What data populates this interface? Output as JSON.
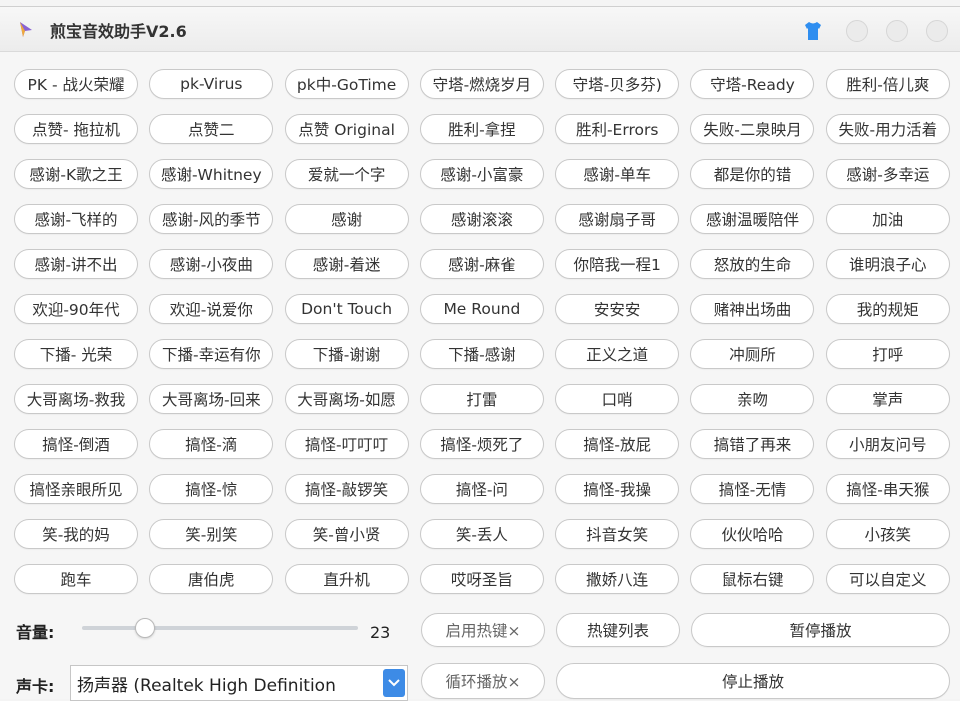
{
  "app": {
    "title": "煎宝音效助手V2.6"
  },
  "sound_buttons": [
    "PK - 战火荣耀",
    "pk-Virus",
    "pk中-GoTime",
    "守塔-燃烧岁月",
    "守塔-贝多芬)",
    "守塔-Ready",
    "胜利-倍儿爽",
    "点赞- 拖拉机",
    "点赞二",
    "点赞 Original",
    "胜利-拿捏",
    "胜利-Errors",
    "失败-二泉映月",
    "失败-用力活着",
    "感谢-K歌之王",
    "感谢-Whitney",
    "爱就一个字",
    "感谢-小富豪",
    "感谢-单车",
    "都是你的错",
    "感谢-多幸运",
    "感谢-飞样的",
    "感谢-风的季节",
    "感谢",
    "感谢滚滚",
    "感谢扇子哥",
    "感谢温暖陪伴",
    "加油",
    "感谢-讲不出",
    "感谢-小夜曲",
    "感谢-着迷",
    "感谢-麻雀",
    "你陪我一程1",
    "怒放的生命",
    "谁明浪子心",
    "欢迎-90年代",
    "欢迎-说爱你",
    "Don't Touch",
    "Me Round",
    "安安安",
    "赌神出场曲",
    "我的规矩",
    "下播- 光荣",
    "下播-幸运有你",
    "下播-谢谢",
    "下播-感谢",
    "正义之道",
    "冲厕所",
    "打呼",
    "大哥离场-救我",
    "大哥离场-回来",
    "大哥离场-如愿",
    "打雷",
    "口哨",
    "亲吻",
    "掌声",
    "搞怪-倒酒",
    "搞怪-滴",
    "搞怪-叮叮叮",
    "搞怪-烦死了",
    "搞怪-放屁",
    "搞错了再来",
    "小朋友问号",
    "搞怪亲眼所见",
    "搞怪-惊",
    "搞怪-敲锣笑",
    "搞怪-问",
    "搞怪-我操",
    "搞怪-无情",
    "搞怪-串天猴",
    "笑-我的妈",
    "笑-别笑",
    "笑-曾小贤",
    "笑-丢人",
    "抖音女笑",
    "伙伙哈哈",
    "小孩笑",
    "跑车",
    "唐伯虎",
    "直升机",
    "哎呀圣旨",
    "撒娇八连",
    "鼠标右键",
    "可以自定义"
  ],
  "volume": {
    "label": "音量:",
    "value": "23",
    "level_percent": 23
  },
  "sound_card": {
    "label": "声卡:",
    "selected": "扬声器 (Realtek High Definition"
  },
  "controls": {
    "hotkey_toggle": "启用热键×",
    "hotkey_list": "热键列表",
    "pause": "暂停播放",
    "loop_toggle": "循环播放×",
    "stop": "停止播放"
  },
  "icons": {
    "app": "ticket-icon",
    "skin": "shirt-icon",
    "accent": "#3d8be6"
  }
}
